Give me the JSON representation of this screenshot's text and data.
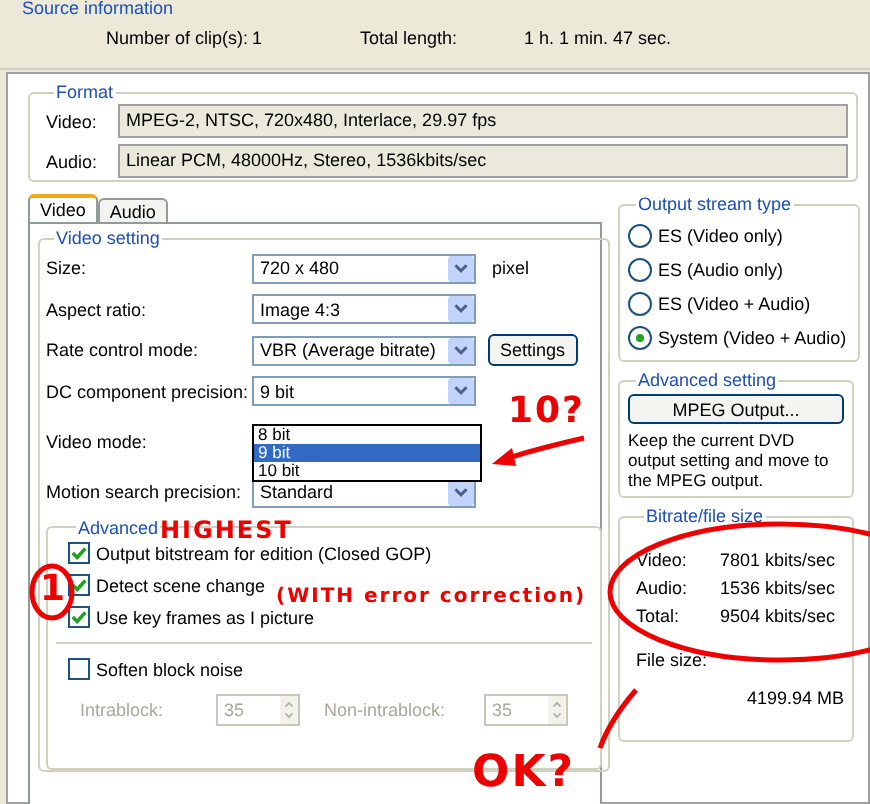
{
  "source_information": {
    "legend": "Source information",
    "clips_label": "Number of clip(s):",
    "clips_value": "1",
    "length_label": "Total length:",
    "length_value": "1 h. 1 min. 47 sec."
  },
  "format": {
    "legend": "Format",
    "rows": [
      {
        "label": "Video:",
        "value": "MPEG-2, NTSC, 720x480, Interlace, 29.97 fps"
      },
      {
        "label": "Audio:",
        "value": "Linear PCM, 48000Hz, Stereo, 1536kbits/sec"
      }
    ]
  },
  "tabs": [
    {
      "label": "Video",
      "selected": true
    },
    {
      "label": "Audio",
      "selected": false
    }
  ],
  "video_setting": {
    "legend": "Video setting",
    "rows": [
      {
        "kind": "combo",
        "label": "Size:",
        "value": "720 x 480",
        "suffix": "pixel"
      },
      {
        "kind": "combo",
        "label": "Aspect ratio:",
        "value": "Image 4:3"
      },
      {
        "kind": "combo",
        "label": "Rate control mode:",
        "value": "VBR (Average bitrate)",
        "button": "Settings"
      },
      {
        "kind": "combo",
        "label": "DC component precision:",
        "value": "9 bit"
      },
      {
        "kind": "plain",
        "label": "Video mode:"
      },
      {
        "kind": "combo",
        "label": "Motion search precision:",
        "value": "Standard"
      }
    ],
    "dropdown": [
      {
        "label": "8 bit",
        "selected": false
      },
      {
        "label": "9 bit",
        "selected": true
      },
      {
        "label": "10 bit",
        "selected": false
      }
    ]
  },
  "advanced": {
    "legend": "Advanced",
    "checkboxes": [
      {
        "label": "Output bitstream for edition (Closed GOP)",
        "checked": true
      },
      {
        "label": "Detect scene change",
        "checked": true
      },
      {
        "label": "Use key frames as I picture",
        "checked": true
      }
    ],
    "soften": {
      "label": "Soften block noise",
      "checked": false
    },
    "spinners": [
      {
        "label": "Intrablock:",
        "value": "35",
        "disabled": true
      },
      {
        "label": "Non-intrablock:",
        "value": "35",
        "disabled": true
      }
    ]
  },
  "output_stream_type": {
    "legend": "Output stream type",
    "options": [
      {
        "label": "ES (Video only)",
        "selected": false
      },
      {
        "label": "ES (Audio only)",
        "selected": false
      },
      {
        "label": "ES (Video + Audio)",
        "selected": false
      },
      {
        "label": "System (Video + Audio)",
        "selected": true
      }
    ]
  },
  "advanced_setting": {
    "legend": "Advanced setting",
    "button": "MPEG Output...",
    "note": "Keep the current DVD output setting and move to the MPEG output."
  },
  "bitrate": {
    "legend": "Bitrate/file size",
    "rows": [
      {
        "label": "Video:",
        "value": "7801 kbits/sec"
      },
      {
        "label": "Audio:",
        "value": "1536 kbits/sec"
      },
      {
        "label": "Total:",
        "value": "9504 kbits/sec"
      }
    ],
    "file_size_label": "File size:",
    "file_size_value": "4199.94 MB"
  },
  "annotations": [
    {
      "kind": "ten",
      "text": "10?"
    },
    {
      "kind": "highest",
      "text": "HIGHEST"
    },
    {
      "kind": "one",
      "text": "1"
    },
    {
      "kind": "correction",
      "text": "(WITH error correction)"
    },
    {
      "kind": "ok",
      "text": "OK?"
    }
  ]
}
